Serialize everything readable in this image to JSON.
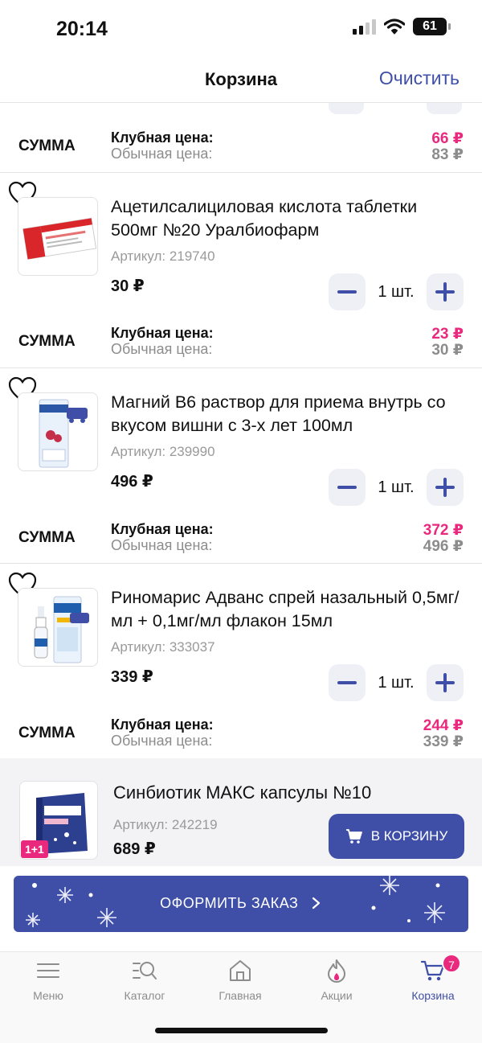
{
  "status_bar": {
    "time": "20:14",
    "battery": "61"
  },
  "header": {
    "title": "Корзина",
    "clear_label": "Очистить"
  },
  "labels": {
    "sum": "СУММА",
    "club_price": "Клубная цена:",
    "regular_price": "Обычная цена:"
  },
  "top_sum": {
    "club_price": "66 ₽",
    "regular_price": "83 ₽"
  },
  "items": [
    {
      "name": "Ацетилсалициловая кислота таблетки 500мг №20 Уралбиофарм",
      "sku": "Артикул: 219740",
      "price": "30 ₽",
      "quantity": "1 шт.",
      "club_price": "23 ₽",
      "regular_price": "30 ₽"
    },
    {
      "name": "Магний B6 раствор для приема внутрь со вкусом вишни с 3-х лет 100мл",
      "sku": "Артикул: 239990",
      "price": "496 ₽",
      "quantity": "1 шт.",
      "club_price": "372 ₽",
      "regular_price": "496 ₽"
    },
    {
      "name": "Риномарис Адванс спрей назальный 0,5мг/мл + 0,1мг/мл флакон 15мл",
      "sku": "Артикул: 333037",
      "price": "339 ₽",
      "quantity": "1 шт.",
      "club_price": "244 ₽",
      "regular_price": "339 ₽"
    }
  ],
  "recommendation": {
    "name": "Синбиотик МАКС капсулы №10",
    "sku": "Артикул: 242219",
    "price": "689 ₽",
    "badge": "1+1",
    "cart_button": "В КОРЗИНУ"
  },
  "order_button": {
    "label": "ОФОРМИТЬ ЗАКАЗ"
  },
  "tabbar": {
    "tabs": [
      {
        "label": "Меню",
        "icon": "menu-icon"
      },
      {
        "label": "Каталог",
        "icon": "catalog-search-icon"
      },
      {
        "label": "Главная",
        "icon": "home-icon"
      },
      {
        "label": "Акции",
        "icon": "flame-icon"
      },
      {
        "label": "Корзина",
        "icon": "cart-icon"
      }
    ],
    "cart_badge": "7",
    "active_tab": "Корзина"
  },
  "colors": {
    "accent": "#3f4fa8",
    "club_price": "#e8297e",
    "muted": "#8c8c8c"
  }
}
